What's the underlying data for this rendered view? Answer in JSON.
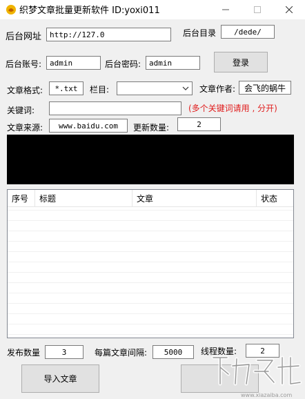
{
  "window": {
    "title": "织梦文章批量更新软件   ID:yoxi011",
    "controls": [
      "minimize",
      "maximize",
      "close"
    ]
  },
  "form": {
    "backend_url_label": "后台网址",
    "backend_url_value": "http://127.0",
    "backend_dir_label": "后台目录",
    "backend_dir_value": "/dede/",
    "account_label": "后台账号:",
    "account_value": "admin",
    "password_label": "后台密码:",
    "password_value": "admin",
    "login_button": "登录",
    "format_label": "文章格式:",
    "format_value": "*.txt",
    "column_label": "栏目:",
    "column_value": "",
    "author_label": "文章作者:",
    "author_value": "会飞的蜗牛",
    "keywords_label": "关键词:",
    "keywords_value": "",
    "keywords_hint": "(多个关键词请用 , 分开)",
    "source_label": "文章来源:",
    "source_value": "www.baidu.com",
    "update_count_label": "更新数量:",
    "update_count_value": "2"
  },
  "table": {
    "columns": [
      "序号",
      "标题",
      "文章",
      "状态"
    ],
    "rows": []
  },
  "bottom": {
    "publish_count_label": "发布数量",
    "publish_count_value": "3",
    "interval_label": "每篇文章间隔:",
    "interval_value": "5000",
    "threads_label": "线程数量:",
    "threads_value": "2",
    "import_button": "导入文章",
    "start_button": ""
  },
  "watermark": {
    "text": "www.xiazaiba.com"
  },
  "colors": {
    "hint_red": "#e01b1b",
    "log_background": "#000000"
  }
}
